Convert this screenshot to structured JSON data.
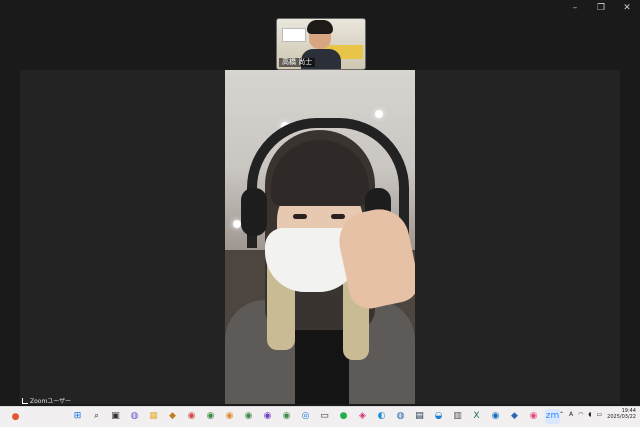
{
  "window_controls": {
    "minimize": "–",
    "restore": "❐",
    "close": "✕"
  },
  "thumbnail": {
    "name": "高橋 尚士",
    "sign_text": "すっき"
  },
  "self_view": {
    "label": "Zoomユーザー"
  },
  "taskbar": {
    "apps": [
      {
        "name": "start-icon",
        "glyph": "⊞",
        "color": "#1a73e8"
      },
      {
        "name": "search-icon",
        "glyph": "⌕",
        "color": "#333"
      },
      {
        "name": "task-view-icon",
        "glyph": "▣",
        "color": "#333"
      },
      {
        "name": "copilot-icon",
        "glyph": "◍",
        "color": "#6b5bd6"
      },
      {
        "name": "file-explorer-icon",
        "glyph": "▦",
        "color": "#e3b23c"
      },
      {
        "name": "app-icon-6",
        "glyph": "◆",
        "color": "#c47a1e"
      },
      {
        "name": "chrome-icon",
        "glyph": "◉",
        "color": "#d64545"
      },
      {
        "name": "chrome-profile-icon",
        "glyph": "◉",
        "color": "#3c8b46"
      },
      {
        "name": "chrome-profile-2-icon",
        "glyph": "◉",
        "color": "#e08a2c"
      },
      {
        "name": "chrome-profile-3-icon",
        "glyph": "◉",
        "color": "#3c8b46"
      },
      {
        "name": "chrome-profile-4-icon",
        "glyph": "◉",
        "color": "#6f42c1"
      },
      {
        "name": "chrome-profile-5-icon",
        "glyph": "◉",
        "color": "#3c8b46"
      },
      {
        "name": "app-icon-13",
        "glyph": "◎",
        "color": "#1a73e8"
      },
      {
        "name": "monitor-icon",
        "glyph": "▭",
        "color": "#333"
      },
      {
        "name": "line-icon",
        "glyph": "●",
        "color": "#21b04b"
      },
      {
        "name": "instagram-icon",
        "glyph": "◈",
        "color": "#d6287a"
      },
      {
        "name": "edge-icon",
        "glyph": "◐",
        "color": "#1b8fd6"
      },
      {
        "name": "app-icon-18",
        "glyph": "◍",
        "color": "#2a6ab0"
      },
      {
        "name": "app-icon-19",
        "glyph": "▤",
        "color": "#1d3557"
      },
      {
        "name": "photos-icon",
        "glyph": "◒",
        "color": "#1d7fd1"
      },
      {
        "name": "app-icon-21",
        "glyph": "▥",
        "color": "#555"
      },
      {
        "name": "excel-icon",
        "glyph": "X",
        "color": "#1e7145"
      },
      {
        "name": "outlook-icon",
        "glyph": "◉",
        "color": "#0f6cbd"
      },
      {
        "name": "app-icon-24",
        "glyph": "◆",
        "color": "#2a6ab0"
      },
      {
        "name": "app-icon-25",
        "glyph": "◉",
        "color": "#e24c7a"
      },
      {
        "name": "zoom-icon",
        "glyph": "zm",
        "color": "#2d8cff"
      }
    ],
    "tray": {
      "chevron": "⌃",
      "ime": "A",
      "wifi": "◠",
      "sound": "◖",
      "battery": "▭",
      "time": "19:44",
      "date": "2025/03/22"
    }
  }
}
